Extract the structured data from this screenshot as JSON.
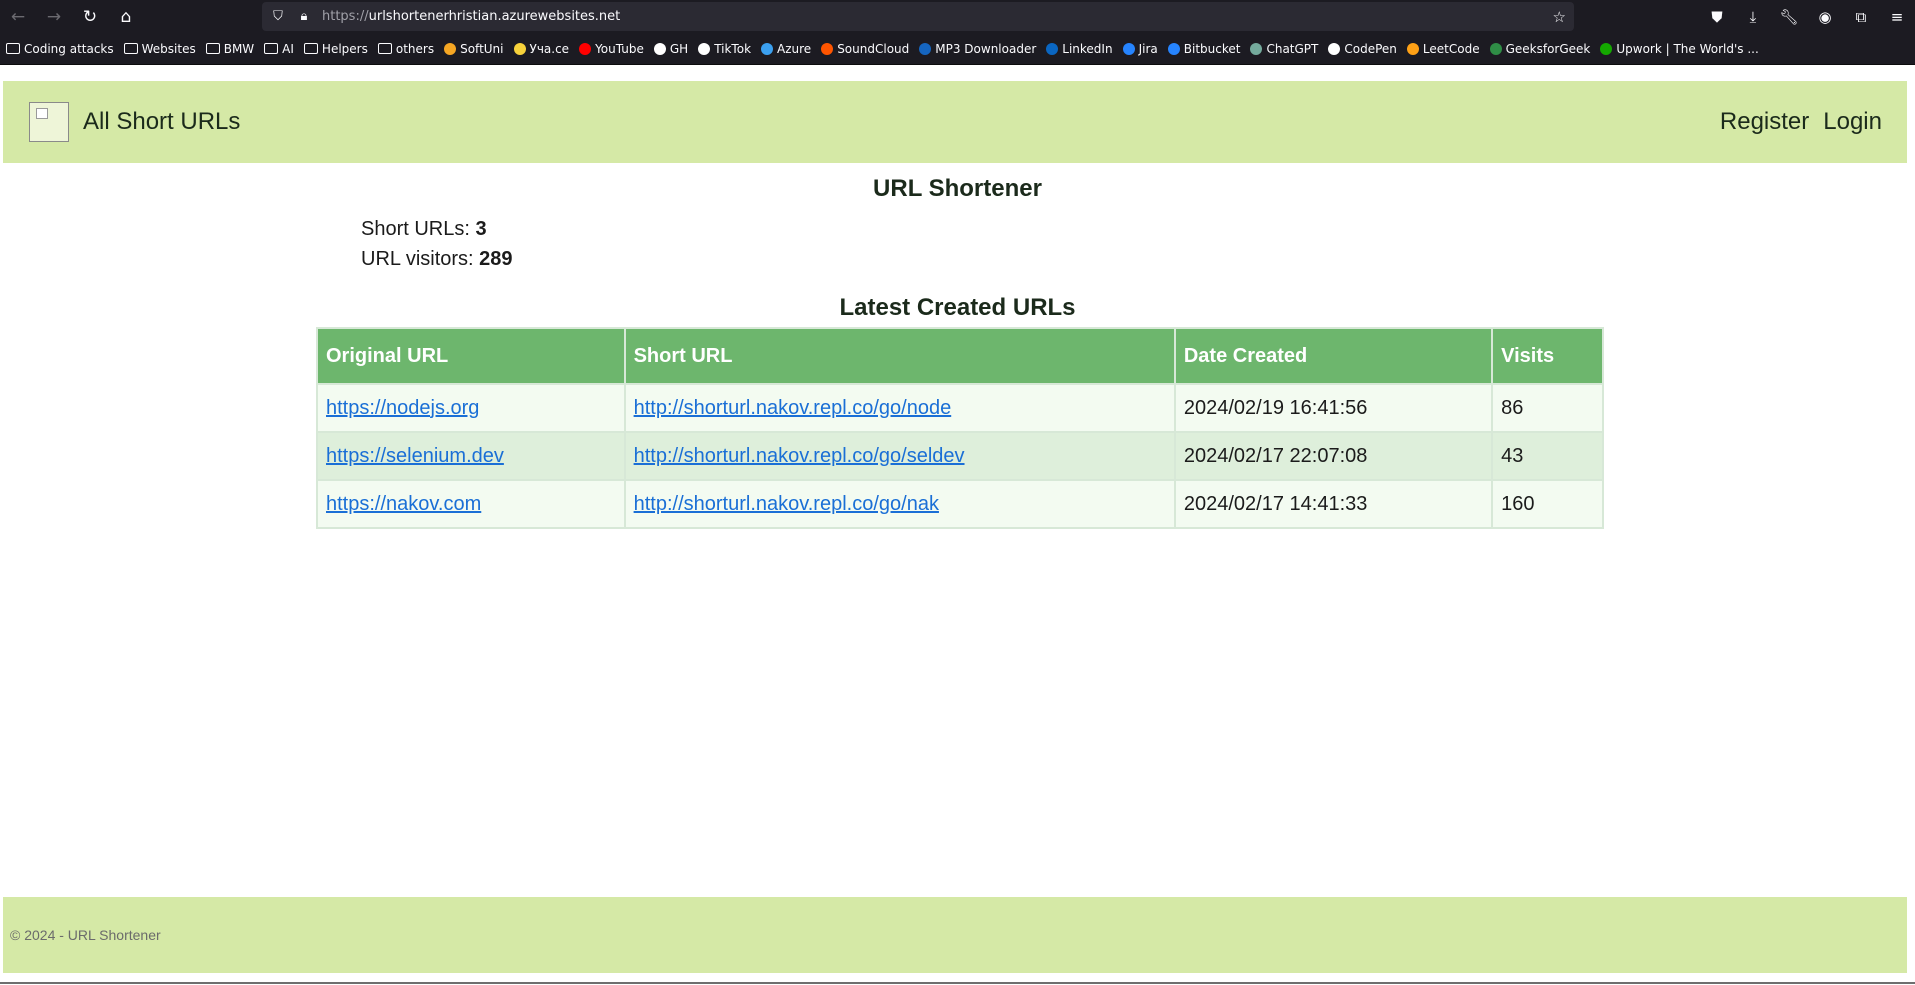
{
  "browser": {
    "url_protocol": "https://",
    "url_host": "urlshortenerhristian.azurewebsites.net"
  },
  "bookmarks": [
    {
      "label": "Coding attacks",
      "icon": "folder-icon"
    },
    {
      "label": "Websites",
      "icon": "folder-icon"
    },
    {
      "label": "BMW",
      "icon": "folder-icon"
    },
    {
      "label": "AI",
      "icon": "folder-icon"
    },
    {
      "label": "Helpers",
      "icon": "folder-icon"
    },
    {
      "label": "others",
      "icon": "folder-icon"
    },
    {
      "label": "SoftUni",
      "icon": "softuni-icon",
      "color": "#f5a623"
    },
    {
      "label": "Уча.се",
      "icon": "uchase-icon",
      "color": "#f7d23b"
    },
    {
      "label": "YouTube",
      "icon": "youtube-icon",
      "color": "#ff0000"
    },
    {
      "label": "GH",
      "icon": "github-icon",
      "color": "#ffffff"
    },
    {
      "label": "TikTok",
      "icon": "tiktok-icon",
      "color": "#ffffff"
    },
    {
      "label": "Azure",
      "icon": "azure-icon",
      "color": "#3ba0f0"
    },
    {
      "label": "SoundCloud",
      "icon": "soundcloud-icon",
      "color": "#ff5500"
    },
    {
      "label": "MP3 Downloader",
      "icon": "mp3-icon",
      "color": "#1565c0"
    },
    {
      "label": "LinkedIn",
      "icon": "linkedin-icon",
      "color": "#0a66c2"
    },
    {
      "label": "Jira",
      "icon": "jira-icon",
      "color": "#2684ff"
    },
    {
      "label": "Bitbucket",
      "icon": "bitbucket-icon",
      "color": "#2684ff"
    },
    {
      "label": "ChatGPT",
      "icon": "chatgpt-icon",
      "color": "#74aa9c"
    },
    {
      "label": "CodePen",
      "icon": "codepen-icon",
      "color": "#ffffff"
    },
    {
      "label": "LeetCode",
      "icon": "leetcode-icon",
      "color": "#ffa116"
    },
    {
      "label": "GeeksforGeek",
      "icon": "geeksforgeeks-icon",
      "color": "#2f8d46"
    },
    {
      "label": "Upwork | The World's ...",
      "icon": "upwork-icon",
      "color": "#14a800"
    }
  ],
  "header": {
    "brand": "All Short URLs",
    "register": "Register",
    "login": "Login"
  },
  "main": {
    "title": "URL Shortener",
    "short_urls_label": "Short URLs: ",
    "short_urls_count": "3",
    "visitors_label": "URL visitors: ",
    "visitors_count": "289",
    "latest_title": "Latest Created URLs"
  },
  "table": {
    "headers": [
      "Original URL",
      "Short URL",
      "Date Created",
      "Visits"
    ],
    "rows": [
      {
        "original": "https://nodejs.org",
        "short": "http://shorturl.nakov.repl.co/go/node",
        "date": "2024/02/19 16:41:56",
        "visits": "86"
      },
      {
        "original": "https://selenium.dev",
        "short": "http://shorturl.nakov.repl.co/go/seldev",
        "date": "2024/02/17 22:07:08",
        "visits": "43"
      },
      {
        "original": "https://nakov.com",
        "short": "http://shorturl.nakov.repl.co/go/nak",
        "date": "2024/02/17 14:41:33",
        "visits": "160"
      }
    ]
  },
  "footer": {
    "text": "© 2024 - URL Shortener"
  },
  "colors": {
    "header_bg": "#d5e9a6",
    "table_header_bg": "#6db66d",
    "link": "#1a6fd6"
  }
}
